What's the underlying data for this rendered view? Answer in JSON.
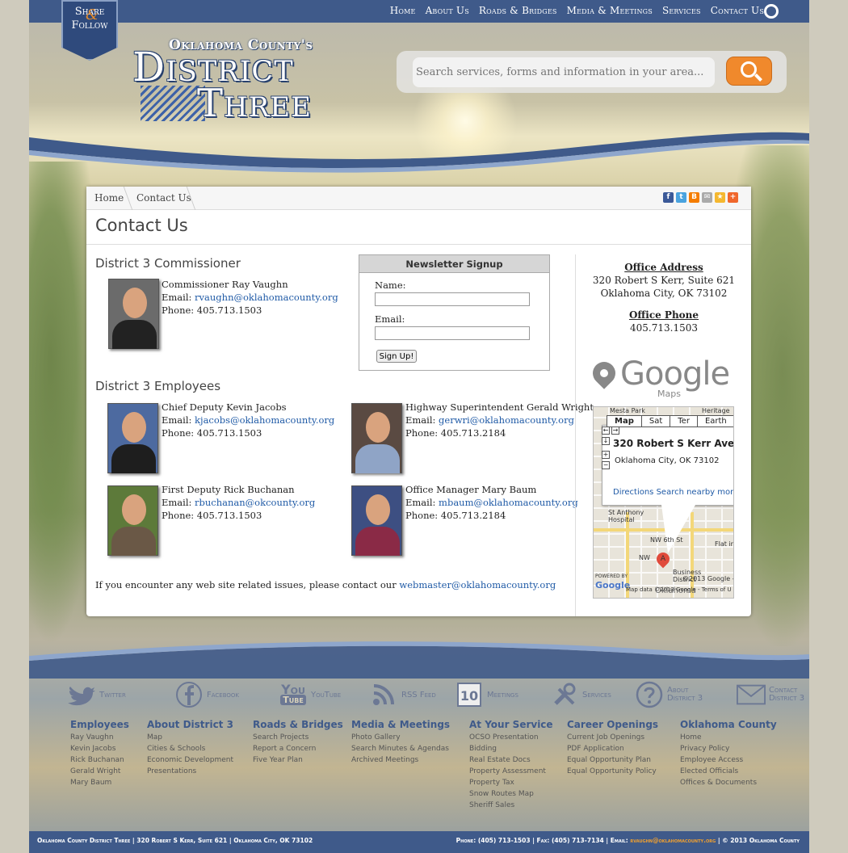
{
  "share": {
    "line1": "Share",
    "amp": "&",
    "line2": "Follow"
  },
  "nav": [
    "Home",
    "About Us",
    "Roads & Bridges",
    "Media & Meetings",
    "Services",
    "Contact Us"
  ],
  "logo": {
    "line1": "Oklahoma County's",
    "line2": "District",
    "line3": "Three"
  },
  "search": {
    "placeholder": "Search services, forms and information in your area..."
  },
  "breadcrumb": [
    "Home",
    "Contact Us"
  ],
  "page_title": "Contact Us",
  "commissioner": {
    "heading": "District 3 Commissioner",
    "name": "Commissioner Ray Vaughn",
    "email_label": "Email:",
    "email": "rvaughn@oklahomacounty.org",
    "phone": "Phone: 405.713.1503"
  },
  "employees": {
    "heading": "District 3 Employees",
    "people": [
      {
        "name": "Chief Deputy Kevin Jacobs",
        "email": "kjacobs@oklahomacounty.org",
        "phone": "Phone: 405.713.1503"
      },
      {
        "name": "Highway Superintendent Gerald Wright",
        "email": "gerwri@oklahomacounty.org",
        "phone": "Phone: 405.713.2184"
      },
      {
        "name": "First Deputy Rick Buchanan",
        "email": "rbuchanan@okcounty.org",
        "phone": "Phone: 405.713.1503"
      },
      {
        "name": "Office Manager Mary Baum",
        "email": "mbaum@oklahomacounty.org",
        "phone": "Phone: 405.713.2184"
      }
    ]
  },
  "newsletter": {
    "title": "Newsletter Signup",
    "name_label": "Name:",
    "email_label": "Email:",
    "button": "Sign Up!"
  },
  "office": {
    "address_label": "Office Address",
    "address1": "320 Robert S Kerr, Suite 621",
    "address2": "Oklahoma City, OK 73102",
    "phone_label": "Office Phone",
    "phone": "405.713.1503"
  },
  "map": {
    "logo": "Google",
    "logo_sub": "Maps",
    "tabs": [
      "Map",
      "Sat",
      "Ter",
      "Earth"
    ],
    "address": "320 Robert S Kerr Ave #6",
    "city": "Oklahoma City, OK 73102",
    "links": "Directions    Search nearby    mor",
    "top_label": "Mesta Park",
    "heritage": "Heritage",
    "hosp": "St Anthony\nHospital",
    "nw6": "NW 6th St",
    "nw": "NW",
    "flat": "Flat ir",
    "business": "Business\nDistrict",
    "copy": "©2013 Google -",
    "data": "Map data ©2013 Google - Terms of U",
    "powered": "POWERED BY",
    "glogo": "Google",
    "okc": "Oklahoma",
    "marker": "A"
  },
  "webmaster": {
    "text": "If you encounter any web site related issues, please contact our ",
    "email": "webmaster@oklahomacounty.org"
  },
  "footer_icons": [
    "Twitter",
    "Facebook",
    "YouTube",
    "RSS Feed",
    "Meetings",
    "Services",
    "About District 3",
    "Contact District 3"
  ],
  "footer_icon_glyphs": {
    "youtube_you": "You",
    "youtube_tube": "Tube",
    "calendar": "10"
  },
  "footer_cols": [
    {
      "title": "Employees",
      "items": [
        "Ray Vaughn",
        "Kevin Jacobs",
        "Rick Buchanan",
        "Gerald Wright",
        "Mary Baum"
      ]
    },
    {
      "title": "About District 3",
      "items": [
        "Map",
        "Cities & Schools",
        "Economic Development",
        "Presentations"
      ]
    },
    {
      "title": "Roads & Bridges",
      "items": [
        "Search Projects",
        "Report a Concern",
        "Five Year Plan"
      ]
    },
    {
      "title": "Media & Meetings",
      "items": [
        "Photo Gallery",
        "Search Minutes & Agendas",
        "Archived Meetings"
      ]
    },
    {
      "title": "At Your Service",
      "items": [
        "OCSO Presentation",
        "Bidding",
        "Real Estate Docs",
        "Property Assessment",
        "Property Tax",
        "Snow Routes Map",
        "Sheriff Sales"
      ]
    },
    {
      "title": "Career Openings",
      "items": [
        "Current Job Openings",
        "PDF Application",
        "Equal Opportunity Plan",
        "Equal Opportunity Policy"
      ]
    },
    {
      "title": "Oklahoma County",
      "items": [
        "Home",
        "Privacy Policy",
        "Employee Access",
        "Elected Officials",
        "Offices & Documents"
      ]
    }
  ],
  "bottom": {
    "left": "Oklahoma County District Three | 320 Robert S Kerr, Suite 621 | Oklahoma City, OK 73102",
    "phone": "Phone: (405) 713-1503 | Fax: (405) 713-7134 | Email: ",
    "email": "rvaughn@oklahomacounty.org",
    "copy": " | © 2013 Oklahoma County"
  },
  "colors": {
    "brand": "#3f5a8a",
    "accent": "#f0892c",
    "link": "#1f5aa6"
  }
}
